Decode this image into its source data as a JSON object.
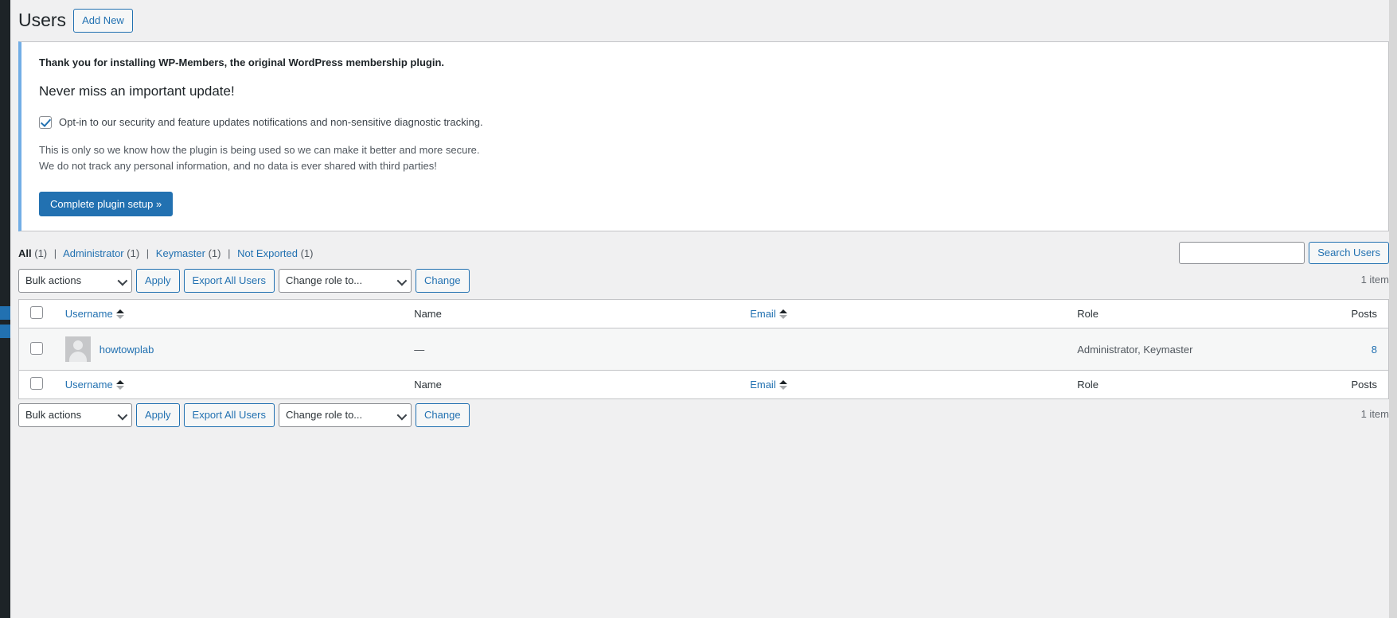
{
  "header": {
    "title": "Users",
    "add_new_label": "Add New"
  },
  "notice": {
    "thank_you": "Thank you for installing WP-Members, the original WordPress membership plugin.",
    "heading": "Never miss an important update!",
    "optin_label": "Opt-in to our security and feature updates notifications and non-sensitive diagnostic tracking.",
    "detail_line1": "This is only so we know how the plugin is being used so we can make it better and more secure.",
    "detail_line2": "We do not track any personal information, and no data is ever shared with third parties!",
    "cta_label": "Complete plugin setup »",
    "optin_checked": true,
    "accent_color": "#72aee6"
  },
  "filters": {
    "items": [
      {
        "label": "All",
        "count": "(1)",
        "current": true
      },
      {
        "label": "Administrator",
        "count": "(1)",
        "current": false
      },
      {
        "label": "Keymaster",
        "count": "(1)",
        "current": false
      },
      {
        "label": "Not Exported",
        "count": "(1)",
        "current": false
      }
    ],
    "separator": "|"
  },
  "search": {
    "value": "",
    "placeholder": "",
    "button_label": "Search Users"
  },
  "tablenav_top": {
    "bulk_actions_label": "Bulk actions",
    "apply_label": "Apply",
    "export_label": "Export All Users",
    "change_role_label": "Change role to...",
    "change_label": "Change",
    "displaying_num": "1 item"
  },
  "tablenav_bottom": {
    "bulk_actions_label": "Bulk actions",
    "apply_label": "Apply",
    "export_label": "Export All Users",
    "change_role_label": "Change role to...",
    "change_label": "Change",
    "displaying_num": "1 item"
  },
  "table": {
    "columns": {
      "username": "Username",
      "name": "Name",
      "email": "Email",
      "role": "Role",
      "posts": "Posts"
    },
    "rows": [
      {
        "username": "howtowplab",
        "name": "—",
        "email": "",
        "role": "Administrator, Keymaster",
        "posts": "8"
      }
    ]
  },
  "colors": {
    "link": "#2271b1",
    "admin_bar": "#1d2327",
    "page_bg": "#f0f0f1",
    "row_bg": "#f6f7f7"
  }
}
